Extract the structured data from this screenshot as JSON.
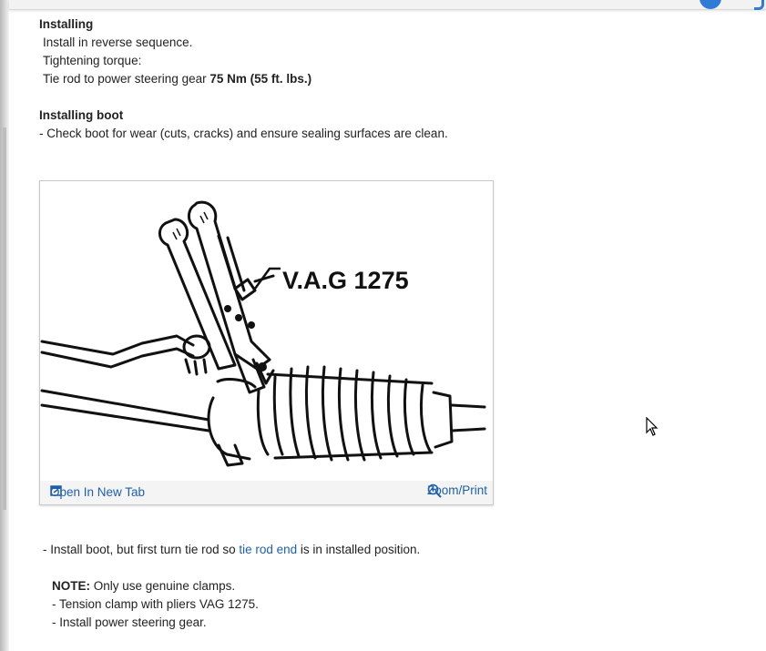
{
  "section_installing": {
    "heading": "Installing",
    "line1": "Install in reverse sequence.",
    "line2": "Tightening torque:",
    "line3_text": "Tie rod to power steering gear ",
    "line3_bold": "75 Nm (55 ft. lbs.)"
  },
  "section_boot": {
    "heading": "Installing boot",
    "step1": "-  Check boot for wear (cuts, cracks) and ensure sealing surfaces are clean."
  },
  "figure": {
    "callout": "V.A.G 1275",
    "open_tab_label": "Open In New Tab",
    "zoom_label": "Zoom/Print"
  },
  "section_after": {
    "step_prefix": "-  Install boot, but first turn tie rod so ",
    "step_link": "tie rod end",
    "step_suffix": " is in installed position.",
    "note_label": "NOTE:",
    "note_text": " Only use genuine clamps.",
    "bullet1": "-  Tension clamp with pliers VAG 1275.",
    "bullet2": "-  Install power steering gear."
  },
  "colors": {
    "link": "#1f5fa8",
    "text": "#222222",
    "accent": "#2f7bd6"
  }
}
